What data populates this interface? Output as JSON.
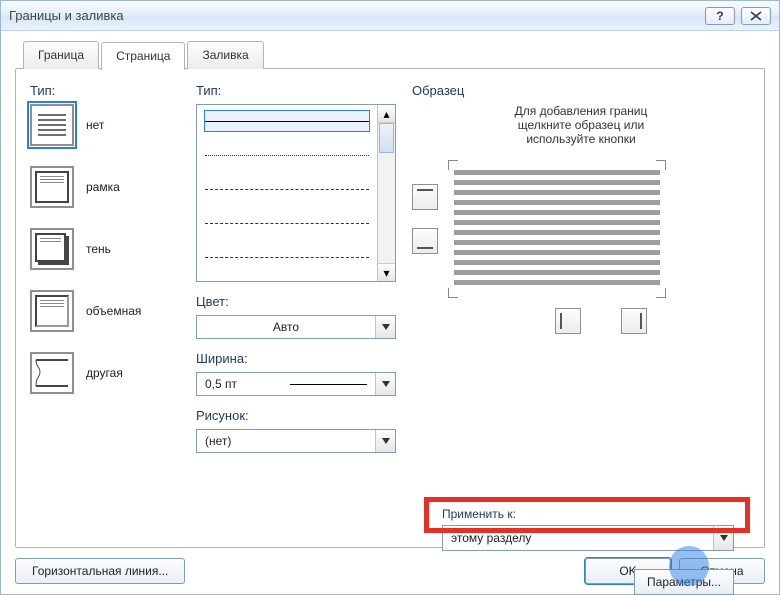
{
  "window": {
    "title": "Границы и заливка"
  },
  "tabs": {
    "border": "Граница",
    "page": "Страница",
    "fill": "Заливка"
  },
  "left": {
    "label": "Тип:",
    "items": [
      {
        "label": "нет"
      },
      {
        "label": "рамка"
      },
      {
        "label": "тень"
      },
      {
        "label": "объемная"
      },
      {
        "label": "другая"
      }
    ]
  },
  "mid": {
    "style_label": "Тип:",
    "color_label": "Цвет:",
    "color_value": "Авто",
    "width_label": "Ширина:",
    "width_value": "0,5 пт",
    "art_label": "Рисунок:",
    "art_value": "(нет)"
  },
  "right": {
    "label": "Образец",
    "hint1": "Для добавления границ",
    "hint2": "щелкните образец или",
    "hint3": "используйте кнопки"
  },
  "apply": {
    "label": "Применить к:",
    "value": "этому разделу",
    "params": "Параметры..."
  },
  "footer": {
    "hline": "Горизонтальная линия...",
    "ok": "OK",
    "cancel": "Отмена"
  }
}
